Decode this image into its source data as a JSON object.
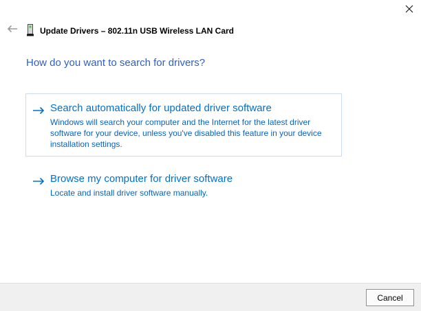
{
  "window": {
    "title": "Update Drivers – 802.11n USB Wireless LAN Card"
  },
  "main": {
    "heading": "How do you want to search for drivers?",
    "options": [
      {
        "title": "Search automatically for updated driver software",
        "description": "Windows will search your computer and the Internet for the latest driver software for your device, unless you've disabled this feature in your device installation settings."
      },
      {
        "title": "Browse my computer for driver software",
        "description": "Locate and install driver software manually."
      }
    ]
  },
  "footer": {
    "cancel_label": "Cancel"
  },
  "icons": {
    "back": "back-arrow-icon",
    "close": "close-icon",
    "device": "usb-device-icon",
    "option_bullet": "forward-arrow-icon"
  },
  "colors": {
    "heading_blue": "#2f5ec4",
    "link_blue": "#0070d0",
    "description_blue": "#0563c1",
    "option_border": "#cbdcec",
    "footer_bg": "#f0f0f0",
    "device_led_green": "#3dcc3d"
  }
}
